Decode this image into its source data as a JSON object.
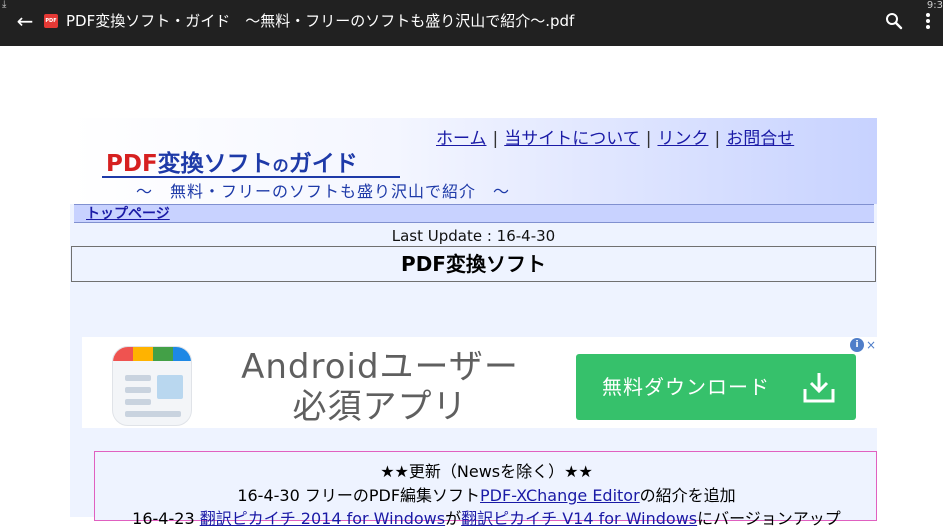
{
  "statusbar": {
    "download_icon": "⤓",
    "clock": "9:3"
  },
  "appbar": {
    "back_icon": "←",
    "pdf_icon_label": "PDF",
    "title": "PDF変換ソフト・ガイド　～無料・フリーのソフトも盛り沢山で紹介～.pdf"
  },
  "header": {
    "links": [
      "ホーム",
      "当サイトについて",
      "リンク",
      "お問合せ"
    ],
    "separator": "|",
    "logo_red": "PDF",
    "logo_blue1": "変換ソフト",
    "logo_no": "の",
    "logo_blue2": "ガイド",
    "subtitle": "～　無料・フリーのソフトも盛り沢山で紹介　～"
  },
  "nav": {
    "top_page": "トップページ"
  },
  "content": {
    "last_update": "Last Update : 16-4-30",
    "page_title": "PDF変換ソフト"
  },
  "ad": {
    "headline_line1": "Androidユーザー",
    "headline_line2": "必須アプリ",
    "button_label": "無料ダウンロード",
    "info_icon": "i",
    "close_icon": "×",
    "icon_colors": [
      "#ef5350",
      "#ffb300",
      "#43a047",
      "#1e88e5"
    ]
  },
  "updates": {
    "heading": "★★更新（Newsを除く）★★",
    "row1_prefix": "16-4-30 フリーのPDF編集ソフト",
    "row1_link": "PDF-XChange Editor",
    "row1_suffix": "の紹介を追加",
    "row2_prefix": "16-4-23 ",
    "row2_link1": "翻訳ピカイチ 2014 for Windows",
    "row2_mid": "が",
    "row2_link2": "翻訳ピカイチ V14 for Windows",
    "row2_suffix": "にバージョンアップ"
  }
}
